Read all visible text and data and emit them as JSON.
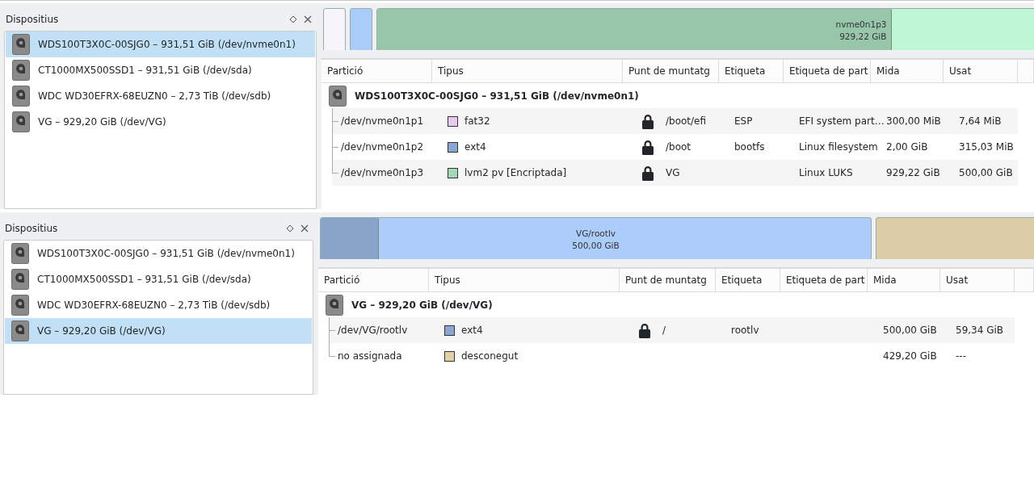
{
  "views": [
    {
      "devices_panel": {
        "title": "Dispositius",
        "items": [
          {
            "label": "WDS100T3X0C-00SJG0 – 931,51 GiB (/dev/nvme0n1)",
            "selected": true
          },
          {
            "label": "CT1000MX500SSD1 – 931,51 GiB (/dev/sda)",
            "selected": false
          },
          {
            "label": "WDC WD30EFRX-68EUZN0 – 2,73 TiB (/dev/sdb)",
            "selected": false
          },
          {
            "label": "VG – 929,20 GiB (/dev/VG)",
            "selected": false
          }
        ]
      },
      "partition_map": [
        {
          "kind": "narrow",
          "color": "#f8f4fb"
        },
        {
          "kind": "narrow",
          "color": "#aaccf8"
        },
        {
          "kind": "rest",
          "color": "#bdf7d4",
          "level": 0.78,
          "name": "nvme0n1p3",
          "size": "929,22 GiB"
        }
      ],
      "table": {
        "columns": [
          "Partició",
          "Tipus",
          "Punt de muntatg",
          "Etiqueta",
          "Etiqueta de part",
          "Mida",
          "Usat"
        ],
        "device": {
          "label": "WDS100T3X0C-00SJG0 – 931,51 GiB (/dev/nvme0n1)",
          "children": [
            {
              "partition": "/dev/nvme0n1p1",
              "type": "fat32",
              "color": "#e8c9f0",
              "locked": true,
              "mount_point": "/boot/efi",
              "label": "ESP",
              "partition_label": "EFI system part…",
              "size": "300,00 MiB",
              "used": "7,64 MiB"
            },
            {
              "partition": "/dev/nvme0n1p2",
              "type": "ext4",
              "color": "#8aa6d3",
              "locked": true,
              "mount_point": "/boot",
              "label": "bootfs",
              "partition_label": "Linux filesystem",
              "size": "2,00 GiB",
              "used": "315,03 MiB"
            },
            {
              "partition": "/dev/nvme0n1p3",
              "type": "lvm2 pv [Encriptada]",
              "color": "#a4d8b4",
              "locked": true,
              "mount_point": "VG",
              "partition_label": "Linux LUKS",
              "size": "929,22 GiB",
              "used": "500,00 GiB"
            }
          ]
        }
      }
    },
    {
      "devices_panel": {
        "title": "Dispositius",
        "items": [
          {
            "label": "WDS100T3X0C-00SJG0 – 931,51 GiB (/dev/nvme0n1)",
            "selected": false
          },
          {
            "label": "CT1000MX500SSD1 – 931,51 GiB (/dev/sda)",
            "selected": false
          },
          {
            "label": "WDC WD30EFRX-68EUZN0 – 2,73 TiB (/dev/sdb)",
            "selected": false
          },
          {
            "label": "VG – 929,20 GiB (/dev/VG)",
            "selected": true
          }
        ]
      },
      "partition_map": [
        {
          "kind": "main",
          "color": "#acccfa",
          "level": 0.104,
          "name": "VG/rootlv",
          "size": "500,00 GiB"
        },
        {
          "kind": "rest",
          "color": "#dccca8"
        }
      ],
      "table": {
        "columns": [
          "Partició",
          "Tipus",
          "Punt de muntatg",
          "Etiqueta",
          "Etiqueta de part",
          "Mida",
          "Usat"
        ],
        "device": {
          "label": "VG – 929,20 GiB (/dev/VG)",
          "children": [
            {
              "partition": "/dev/VG/rootlv",
              "type": "ext4",
              "color": "#8aa6d3",
              "locked": true,
              "mount_point": "/",
              "label": "rootlv",
              "size": "500,00 GiB",
              "used": "59,34 GiB"
            },
            {
              "partition": "no assignada",
              "type": "desconegut",
              "color": "#e0d0a8",
              "locked": false,
              "size": "429,20 GiB",
              "used": "---"
            }
          ]
        }
      }
    }
  ]
}
